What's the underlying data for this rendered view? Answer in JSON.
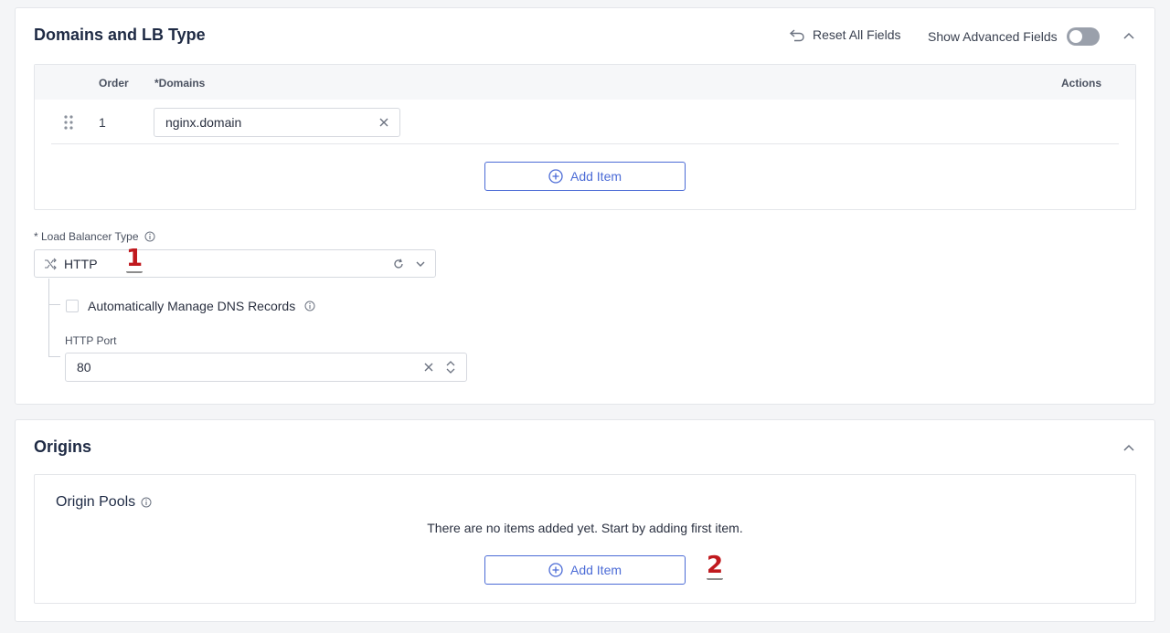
{
  "domains_section": {
    "title": "Domains and LB Type",
    "reset_label": "Reset All Fields",
    "advanced_label": "Show Advanced Fields",
    "advanced_enabled": false,
    "table": {
      "columns": {
        "order": "Order",
        "domains": "*Domains",
        "actions": "Actions"
      },
      "rows": [
        {
          "order": "1",
          "domain": "nginx.domain"
        }
      ],
      "add_label": "Add Item"
    },
    "lb_type": {
      "label": "* Load Balancer Type",
      "value": "HTTP",
      "dns_label": "Automatically Manage DNS Records",
      "dns_checked": false,
      "port_label": "HTTP Port",
      "port_value": "80"
    }
  },
  "origins_section": {
    "title": "Origins",
    "pools_title": "Origin Pools",
    "empty_message": "There are no items added yet. Start by adding first item.",
    "add_label": "Add Item"
  },
  "markers": [
    "1",
    "2"
  ],
  "colors": {
    "accent": "#4b6bd6",
    "marker": "#c0191e",
    "toggle_off": "#9aa0ab"
  }
}
